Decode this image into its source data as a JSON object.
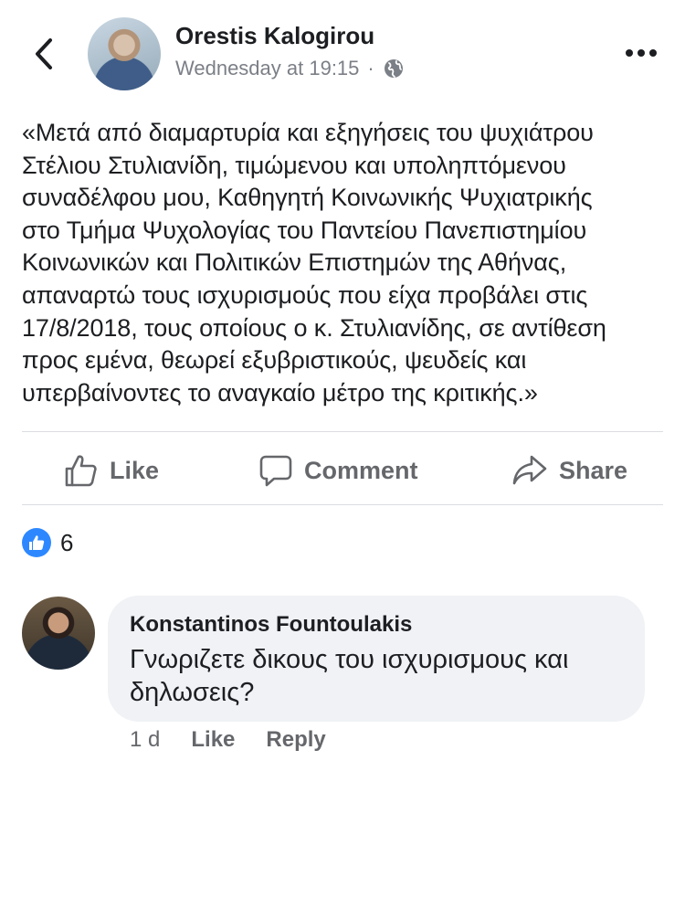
{
  "post": {
    "author": "Orestis Kalogirou",
    "timestamp": "Wednesday at 19:15",
    "meta_separator": "·",
    "privacy_icon": "globe-icon",
    "text_lines": [
      "«Μετά από διαμαρτυρία και εξηγήσεις του ψυχιάτρου",
      "Στέλιου Στυλιανίδη, τιμώμενου και υποληπτόμενου",
      "συναδέλφου μου, Καθηγητή Κοινωνικής Ψυχιατρικής",
      "στο Τμήμα Ψυχολογίας του Παντείου Πανεπιστημίου",
      "Κοινωνικών και Πολιτικών Επιστημών της Αθήνας,",
      "απαναρτώ τους ισχυρισμούς που είχα προβάλει στις",
      "17/8/2018, τους οποίους ο κ. Στυλιανίδης, σε αντίθεση",
      "προς εμένα, θεωρεί εξυβριστικούς, ψευδείς και",
      "υπερβαίνοντες το αναγκαίο μέτρο της κριτικής.»"
    ]
  },
  "actions": {
    "like": "Like",
    "comment": "Comment",
    "share": "Share"
  },
  "reactions": {
    "count": "6",
    "type": "like"
  },
  "comment": {
    "author": "Konstantinos Fountoulakis",
    "text_lines": [
      "Γνωριζετε δικους του ισχυρισμους και",
      "δηλωσεις?"
    ],
    "time": "1 d",
    "like_label": "Like",
    "reply_label": "Reply"
  },
  "colors": {
    "accent": "#2d88ff",
    "secondary_text": "#65676b",
    "bubble": "#f0f2f5"
  }
}
